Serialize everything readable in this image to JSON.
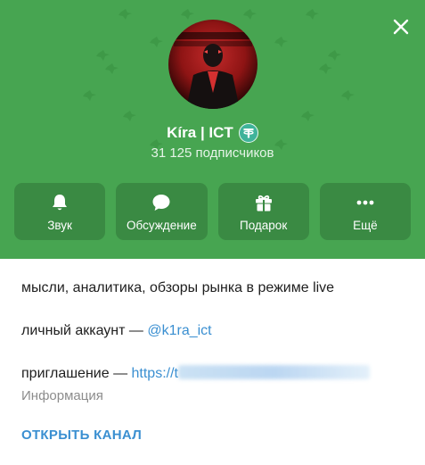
{
  "channel": {
    "name": "Kíra | ICT",
    "subscribers": "31 125 подписчиков",
    "badge_icon": "tether-icon"
  },
  "actions": [
    {
      "label": "Звук",
      "icon": "bell-icon"
    },
    {
      "label": "Обсуждение",
      "icon": "chat-bubble-icon"
    },
    {
      "label": "Подарок",
      "icon": "gift-icon"
    },
    {
      "label": "Ещё",
      "icon": "more-icon"
    }
  ],
  "about": {
    "description": "мысли, аналитика, обзоры рынка в режиме live",
    "personal_label": "личный аккаунт — ",
    "personal_handle": "@k1ra_ict",
    "invite_label": "приглашение — ",
    "invite_link": "https://t"
  },
  "info_label": "Информация",
  "open_channel_label": "ОТКРЫТЬ КАНАЛ",
  "colors": {
    "header_green": "#47a551",
    "button_green": "#3a8a43",
    "link_blue": "#3a8fd1",
    "badge_teal": "#3fb39a"
  }
}
